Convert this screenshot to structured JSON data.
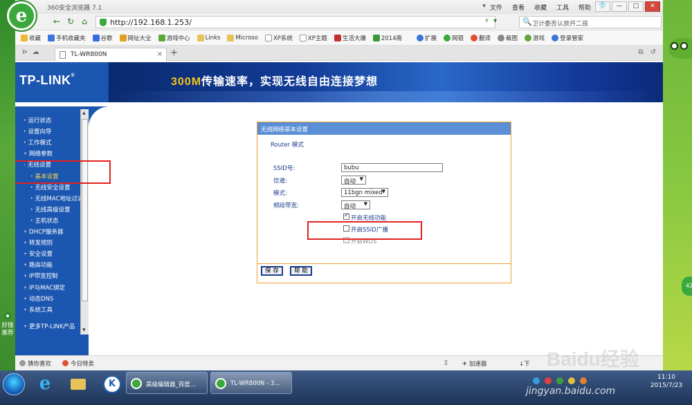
{
  "browser": {
    "app_title": "360安全浏览器 7.1",
    "menus": [
      "文件",
      "查看",
      "收藏",
      "工具",
      "帮助"
    ],
    "win_controls": [
      "✕",
      "—",
      "□",
      "✕"
    ],
    "url": "http://192.168.1.253/",
    "search_placeholder": "卫计委否认放开二孩",
    "favorites": [
      "收藏",
      "手机收藏夹",
      "谷歌",
      "网址大全",
      "游戏中心",
      "Links",
      "Microso",
      "XP系统",
      "XP主题",
      "生活大爆",
      "2014南"
    ],
    "tools": [
      "扩展",
      "网银",
      "翻译",
      "截图",
      "游戏",
      "登录管家"
    ],
    "tab_title": "TL-WR800N",
    "tab_close": "×",
    "new_tab": "+"
  },
  "router": {
    "logo": "TP-LINK",
    "slogan_accent": "300M",
    "slogan_rest": "传输速率，实现无线自由连接梦想",
    "menu": [
      {
        "label": "运行状态",
        "sub": false
      },
      {
        "label": "设置向导",
        "sub": false
      },
      {
        "label": "工作模式",
        "sub": false
      },
      {
        "label": "网络参数",
        "sub": false
      },
      {
        "label": "无线设置",
        "sub": false
      },
      {
        "label": "基本设置",
        "sub": true,
        "active": true
      },
      {
        "label": "无线安全设置",
        "sub": true
      },
      {
        "label": "无线MAC地址过滤",
        "sub": true
      },
      {
        "label": "无线高级设置",
        "sub": true
      },
      {
        "label": "主机状态",
        "sub": true
      },
      {
        "label": "DHCP服务器",
        "sub": false
      },
      {
        "label": "转发规则",
        "sub": false
      },
      {
        "label": "安全设置",
        "sub": false
      },
      {
        "label": "路由功能",
        "sub": false
      },
      {
        "label": "IP带宽控制",
        "sub": false
      },
      {
        "label": "IP与MAC绑定",
        "sub": false
      },
      {
        "label": "动态DNS",
        "sub": false
      },
      {
        "label": "系统工具",
        "sub": false
      },
      {
        "label": "更多TP-LINK产品",
        "sub": false
      }
    ],
    "panel": {
      "title": "无线网络基本设置",
      "mode_text": "Router 模式",
      "ssid_label": "SSID号:",
      "ssid_value": "bubu",
      "channel_label": "信道:",
      "channel_value": "自动",
      "mode_label": "模式:",
      "mode_value": "11bgn mixed",
      "bandwidth_label": "频段带宽:",
      "bandwidth_value": "自动",
      "wireless_enable": "开启无线功能",
      "ssid_broadcast": "开启SSID广播",
      "wds": "开启WDS",
      "save_button": "保 存",
      "help_button": "帮 助"
    }
  },
  "statusbar": {
    "left1": "猜你喜欢",
    "left2": "今日特卖",
    "accel": "加速器",
    "download": "下"
  },
  "desktop": {
    "side_widget": "好搜推荐",
    "speed_badge": "42",
    "tasks": [
      "高级编辑器_百度...",
      "TL-WR800N - 3..."
    ],
    "clock_time": "11:10",
    "clock_date": "2015/7/23",
    "watermark": "jingyan.baidu.com",
    "baidu": "Baidu经验"
  },
  "colors": {
    "router_blue": "#1b56b0",
    "panel_border": "#f0a030",
    "highlight_red": "#e1201f",
    "browser_green": "#3aa83a"
  }
}
